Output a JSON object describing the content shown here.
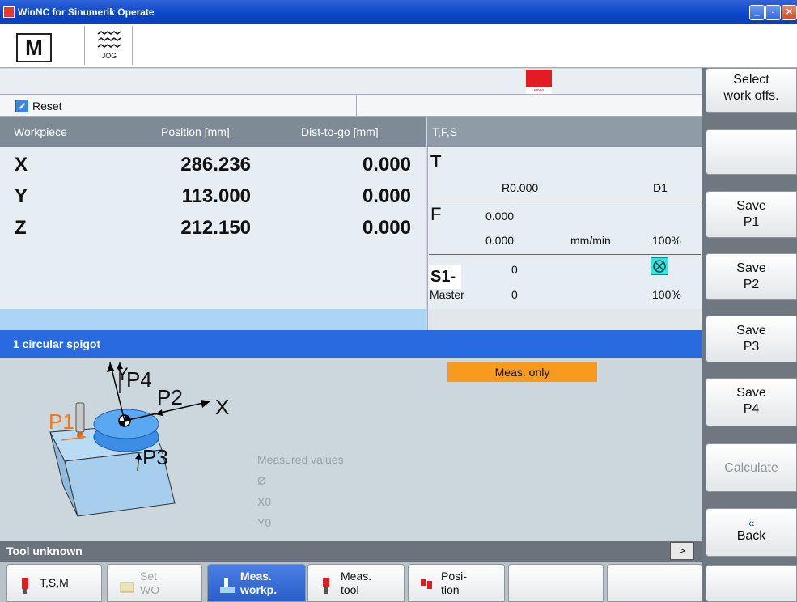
{
  "window": {
    "title": "WinNC for Sinumerik Operate"
  },
  "mode": {
    "machine_icon": "M",
    "jog_label": "JOG"
  },
  "status": {
    "channel_state": "Reset",
    "message": "Tool unknown"
  },
  "axis_table": {
    "headers": {
      "axis": "Workpiece",
      "position": "Position [mm]",
      "dist_to_go": "Dist-to-go [mm]"
    },
    "rows": [
      {
        "name": "X",
        "position": "286.236",
        "dist_to_go": "0.000"
      },
      {
        "name": "Y",
        "position": "113.000",
        "dist_to_go": "0.000"
      },
      {
        "name": "Z",
        "position": "212.150",
        "dist_to_go": "0.000"
      }
    ]
  },
  "tfs": {
    "header": "T,F,S",
    "t_label": "T",
    "radius": "R0.000",
    "d_number": "D1",
    "f_label": "F",
    "f_value1": "0.000",
    "f_value2": "0.000",
    "f_unit": "mm/min",
    "f_override": "100%",
    "s_label": "S1-",
    "s_value": "0",
    "master_label": "Master",
    "master_value": "0",
    "s_override": "100%"
  },
  "cycle": {
    "title": "1 circular spigot",
    "mode_badge": "Meas. only",
    "measured_values_label": "Measured values",
    "values": [
      "Ø",
      "X0",
      "Y0"
    ],
    "sketch_labels": {
      "p1": "P1",
      "p2": "P2",
      "p3": "P3",
      "p4": "P4",
      "x": "X",
      "y": "Y"
    }
  },
  "more_button": ">",
  "vertical_softkeys": [
    {
      "line1": "Select",
      "line2": "work offs."
    },
    {
      "line1": "",
      "line2": ""
    },
    {
      "line1": "Save",
      "line2": "P1"
    },
    {
      "line1": "Save",
      "line2": "P2"
    },
    {
      "line1": "Save",
      "line2": "P3"
    },
    {
      "line1": "Save",
      "line2": "P4"
    },
    {
      "line1": "Calculate",
      "line2": ""
    },
    {
      "chevron": "«",
      "line1": "Back"
    }
  ],
  "horizontal_softkeys": [
    {
      "line1": "T,S,M",
      "line2": ""
    },
    {
      "line1": "Set",
      "line2": "WO"
    },
    {
      "line1": "Meas.",
      "line2": "workp."
    },
    {
      "line1": "Meas.",
      "line2": "tool"
    },
    {
      "line1": "Posi-",
      "line2": "tion"
    }
  ],
  "colors": {
    "accent_blue": "#2a6ae0",
    "badge_orange": "#f79a1e",
    "p1_orange": "#f07a1a"
  }
}
